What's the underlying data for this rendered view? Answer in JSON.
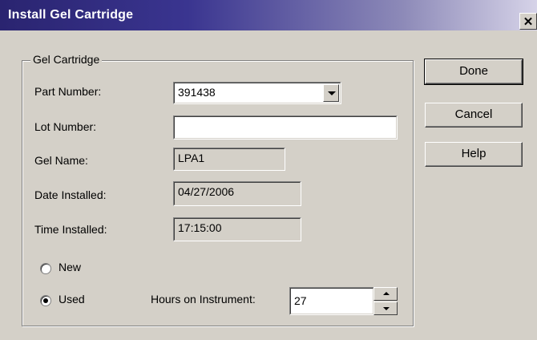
{
  "window": {
    "title": "Install Gel Cartridge",
    "close_label": "✕"
  },
  "group": {
    "title": "Gel Cartridge"
  },
  "fields": {
    "part_number": {
      "label": "Part Number:",
      "value": "391438"
    },
    "lot_number": {
      "label": "Lot Number:",
      "value": ""
    },
    "gel_name": {
      "label": "Gel Name:",
      "value": "LPA1"
    },
    "date_installed": {
      "label": "Date Installed:",
      "value": "04/27/2006"
    },
    "time_installed": {
      "label": "Time Installed:",
      "value": "17:15:00"
    }
  },
  "radios": {
    "new": {
      "label": "New",
      "checked": false
    },
    "used": {
      "label": "Used",
      "checked": true
    }
  },
  "hours": {
    "label": "Hours on Instrument:",
    "value": "27"
  },
  "buttons": {
    "done": "Done",
    "cancel": "Cancel",
    "help": "Help"
  }
}
